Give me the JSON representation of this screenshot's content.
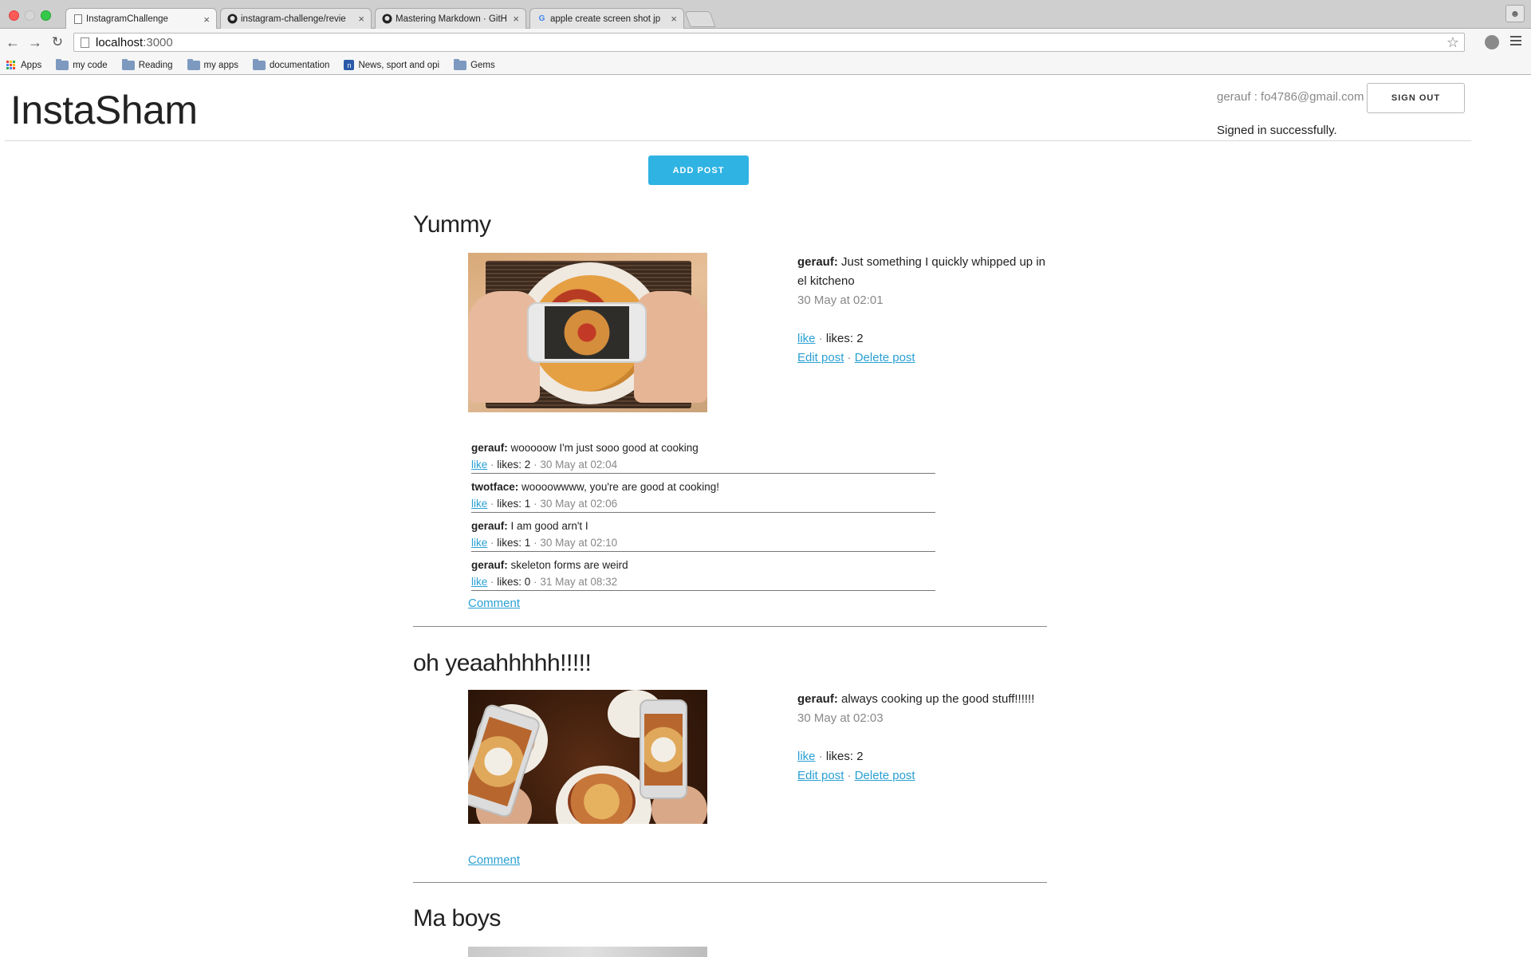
{
  "browser": {
    "tabs": [
      {
        "title": "InstagramChallenge",
        "active": true,
        "icon": "page-icon"
      },
      {
        "title": "instagram-challenge/revie",
        "active": false,
        "icon": "github-icon"
      },
      {
        "title": "Mastering Markdown · GitH",
        "active": false,
        "icon": "github-icon"
      },
      {
        "title": "apple create screen shot jp",
        "active": false,
        "icon": "google-icon"
      }
    ],
    "url": {
      "host": "localhost",
      "port": ":3000"
    },
    "bookmarks": [
      "Apps",
      "my code",
      "Reading",
      "my apps",
      "documentation",
      "News, sport and opi",
      "Gems"
    ]
  },
  "header": {
    "logo": "InstaSham",
    "user_email": "gerauf : fo4786@gmail.com",
    "sign_out": "SIGN OUT",
    "flash": "Signed in successfully."
  },
  "add_post_label": "ADD POST",
  "posts": [
    {
      "title": "Yummy",
      "author": "gerauf:",
      "caption": "Just something I quickly whipped up in el kitcheno",
      "date": "30 May at 02:01",
      "like": "like",
      "likes": "likes: 2",
      "edit": "Edit post",
      "delete": "Delete post",
      "comments": [
        {
          "author": "gerauf:",
          "text": "wooooow I'm just sooo good at cooking",
          "like": "like",
          "likes": "likes: 2",
          "date": "30 May at 02:04"
        },
        {
          "author": "twotface:",
          "text": "woooowwww, you're are good at cooking!",
          "like": "like",
          "likes": "likes: 1",
          "date": "30 May at 02:06"
        },
        {
          "author": "gerauf:",
          "text": "I am good arn't I",
          "like": "like",
          "likes": "likes: 1",
          "date": "30 May at 02:10"
        },
        {
          "author": "gerauf:",
          "text": "skeleton forms are weird",
          "like": "like",
          "likes": "likes: 0",
          "date": "31 May at 08:32"
        }
      ],
      "comment_link": "Comment"
    },
    {
      "title": "oh yeaahhhhh!!!!!",
      "author": "gerauf:",
      "caption": "always cooking up the good stuff!!!!!!",
      "date": "30 May at 02:03",
      "like": "like",
      "likes": "likes: 2",
      "edit": "Edit post",
      "delete": "Delete post",
      "comment_link": "Comment"
    },
    {
      "title": "Ma boys"
    }
  ],
  "separator": "·"
}
